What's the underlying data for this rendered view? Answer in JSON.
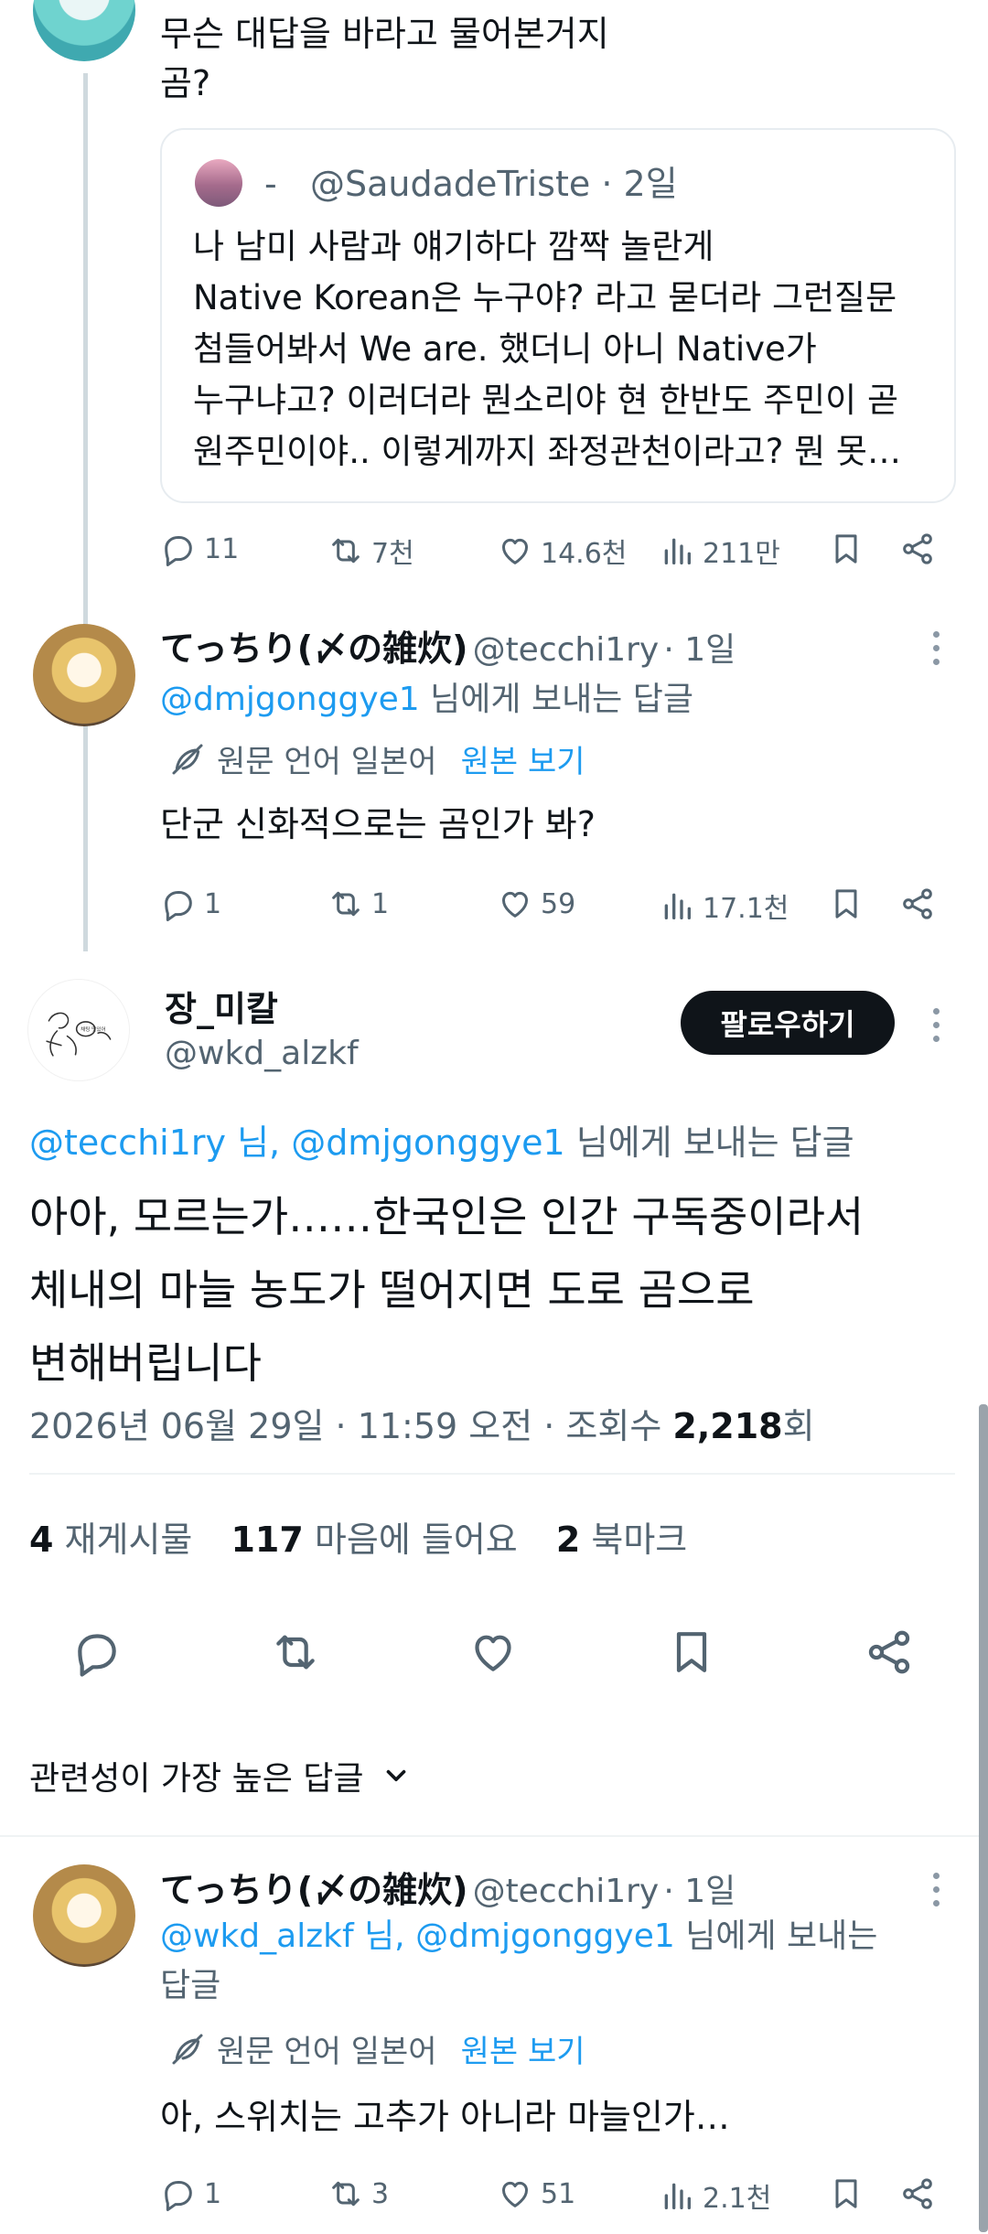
{
  "tweet1": {
    "text_line1": "무슨 대답을 바라고 물어본거지",
    "text_line2": "곰?",
    "quote": {
      "separator": "-",
      "handle": "@SaudadeTriste",
      "time": "· 2일",
      "lines": [
        "나 남미 사람과 얘기하다 깜짝 놀란게",
        "Native Korean은 누구야? 라고 묻더라 그런질문",
        "첨들어봐서 We are. 했더니 아니 Native가",
        "누구냐고? 이러더라 뭔소리야 현 한반도 주민이 곧",
        "원주민이야.. 이렇게까지 좌정관천이라고? 뭔 못…"
      ]
    },
    "actions": {
      "replies": "11",
      "reposts": "7천",
      "likes": "14.6천",
      "views": "211만"
    }
  },
  "tweet2": {
    "name": "てっちり(〆の雑炊)",
    "handle": "@tecchi1ry",
    "time": "· 1일",
    "reply_to_mention": "@dmjgonggye1",
    "reply_to_suffix": "님에게 보내는 답글",
    "translate_note": "원문 언어 일본어",
    "translate_link": "원본 보기",
    "text": "단군 신화적으로는 곰인가 봐?",
    "actions": {
      "replies": "1",
      "reposts": "1",
      "likes": "59",
      "views": "17.1천"
    }
  },
  "main": {
    "name": "장_미칼",
    "handle": "@wkd_alzkf",
    "follow_label": "팔로우하기",
    "avatar_caption": "채팅 맛있어",
    "reply_to_mentions": "@tecchi1ry 님, @dmjgonggye1",
    "reply_to_suffix": "님에게 보내는 답글",
    "text_lines": [
      "아아, 모르는가……한국인은 인간 구독중이라서",
      "체내의 마늘 농도가 떨어지면 도로 곰으로",
      "변해버립니다"
    ],
    "meta_prefix": "2026년 06월 29일 · 11:59 오전 · 조회수 ",
    "views_count": "2,218",
    "views_suffix": "회",
    "stats": {
      "reposts_count": "4",
      "reposts_label": "재게시물",
      "likes_count": "117",
      "likes_label": "마음에 들어요",
      "bookmarks_count": "2",
      "bookmarks_label": "북마크"
    }
  },
  "sort": {
    "label": "관련성이 가장 높은 답글"
  },
  "tweet3": {
    "name": "てっちり(〆の雑炊)",
    "handle": "@tecchi1ry",
    "time": "· 1일",
    "reply_to_mentions": "@wkd_alzkf 님, @dmjgonggye1",
    "reply_to_suffix_line1": "님에게 보내는",
    "reply_to_suffix_line2": "답글",
    "translate_note": "원문 언어 일본어",
    "translate_link": "원본 보기",
    "text": "아, 스위치는 고추가 아니라 마늘인가…",
    "actions": {
      "replies": "1",
      "reposts": "3",
      "likes": "51",
      "views": "2.1천"
    }
  },
  "colors": {
    "link": "#1d9bf0",
    "secondary_text": "#536471",
    "follow_button": "#0f1419"
  }
}
